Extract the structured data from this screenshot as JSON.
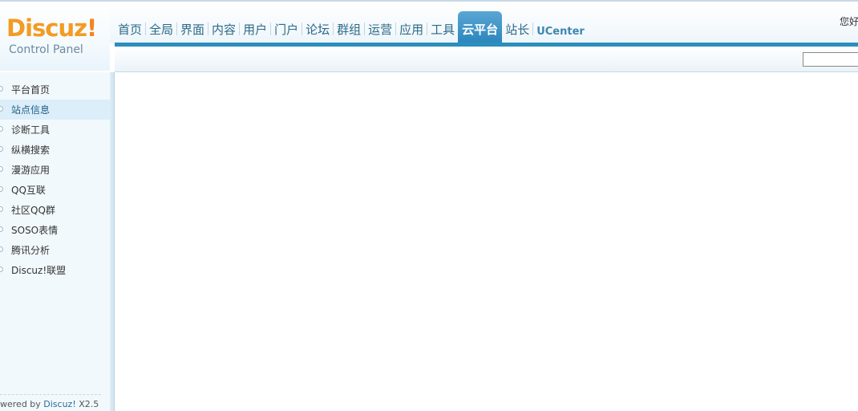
{
  "logo": {
    "part1": "Discuz",
    "part2": "!",
    "subtitle": "Control Panel"
  },
  "nav": [
    {
      "label": "首页",
      "active": false
    },
    {
      "label": "全局",
      "active": false
    },
    {
      "label": "界面",
      "active": false
    },
    {
      "label": "内容",
      "active": false
    },
    {
      "label": "用户",
      "active": false
    },
    {
      "label": "门户",
      "active": false
    },
    {
      "label": "论坛",
      "active": false
    },
    {
      "label": "群组",
      "active": false
    },
    {
      "label": "运营",
      "active": false
    },
    {
      "label": "应用",
      "active": false
    },
    {
      "label": "工具",
      "active": false
    },
    {
      "label": "云平台",
      "active": true
    },
    {
      "label": "站长",
      "active": false
    },
    {
      "label": "UCenter",
      "active": false
    }
  ],
  "greeting": "您好",
  "sidebar": {
    "items": [
      {
        "label": "平台首页",
        "active": false
      },
      {
        "label": "站点信息",
        "active": true
      },
      {
        "label": "诊断工具",
        "active": false
      },
      {
        "label": "纵横搜索",
        "active": false
      },
      {
        "label": "漫游应用",
        "active": false
      },
      {
        "label": "QQ互联",
        "active": false
      },
      {
        "label": "社区QQ群",
        "active": false
      },
      {
        "label": "SOSO表情",
        "active": false
      },
      {
        "label": "腾讯分析",
        "active": false
      },
      {
        "label": "Discuz!联盟",
        "active": false
      }
    ]
  },
  "footer": {
    "prefix": "wered by ",
    "brand": "Discuz!",
    "version": " X2.5"
  },
  "colors": {
    "accent": "#2b8ebd",
    "active_tab": "#3b93c6",
    "logo_orange": "#f39b22",
    "nav_text": "#2b6a88"
  }
}
